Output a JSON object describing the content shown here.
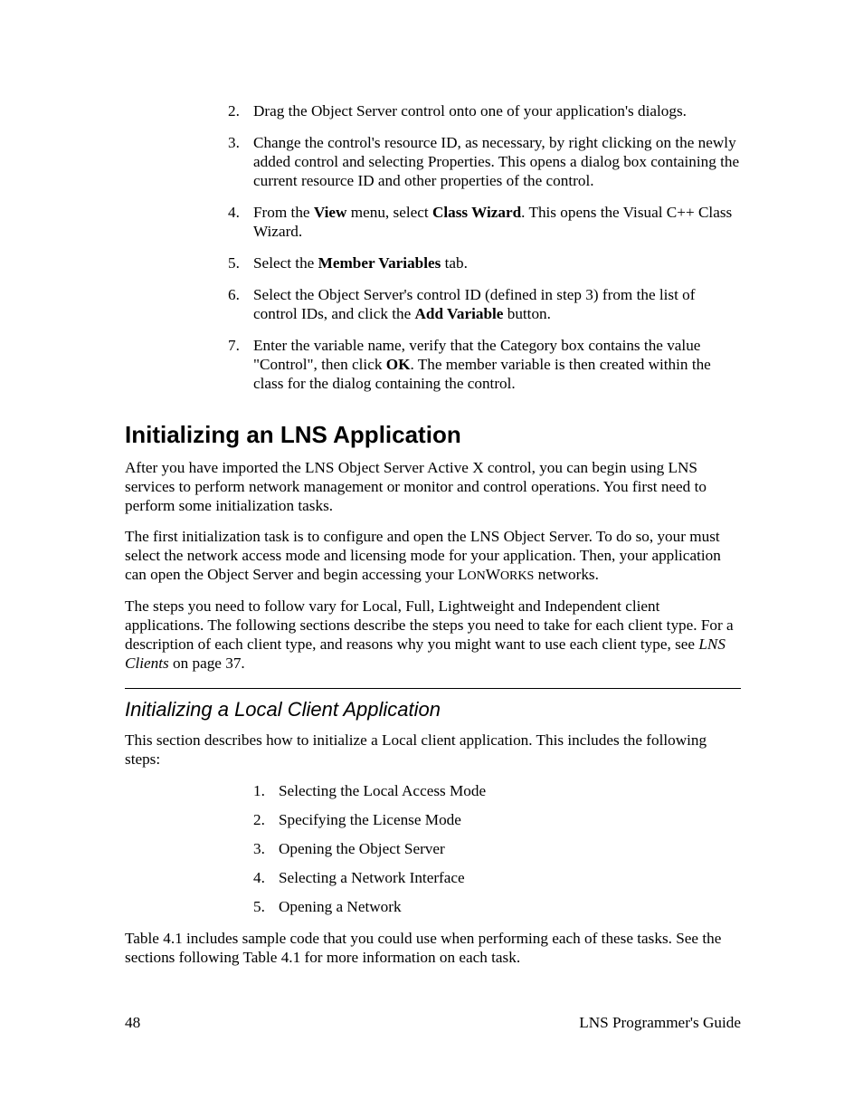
{
  "list1": {
    "n2": "2.",
    "i2": "Drag the Object Server control onto one of your application's dialogs.",
    "n3": "3.",
    "i3": "Change the control's resource ID, as necessary, by right clicking on the newly added control and selecting Properties. This opens a dialog box containing the current resource ID and other properties of the control.",
    "n4": "4.",
    "i4a": "From the ",
    "i4b": "View",
    "i4c": " menu, select ",
    "i4d": "Class Wizard",
    "i4e": ". This opens the Visual C++ Class Wizard.",
    "n5": "5.",
    "i5a": "Select the ",
    "i5b": "Member Variables",
    "i5c": " tab.",
    "n6": "6.",
    "i6a": "Select the Object Server's control ID (defined in step 3) from the list of control IDs, and click the ",
    "i6b": "Add Variable",
    "i6c": " button.",
    "n7": "7.",
    "i7a": "Enter the variable name, verify that the Category box contains the value \"Control\", then click ",
    "i7b": "OK",
    "i7c": ". The member variable is then created within the class for the dialog containing the control."
  },
  "h1": "Initializing an LNS Application",
  "p1": "After you have imported the LNS Object Server Active X control, you can begin using LNS services to perform network management or monitor and control operations. You first need to perform some initialization tasks.",
  "p2a": "The first initialization task is to configure and open the LNS Object Server. To do so, your must select the network access mode and licensing mode for your application. Then, your application can open the Object Server and begin accessing your L",
  "p2b": "ON",
  "p2c": "W",
  "p2d": "ORKS",
  "p2e": " networks.",
  "p3a": "The steps you need to follow vary for Local, Full, Lightweight and Independent client applications. The following sections describe the steps you need to take for each client type. For a description of each client type, and reasons why you might want to use each client type, see ",
  "p3b": "LNS Clients",
  "p3c": " on page 37.",
  "h2": "Initializing a Local Client Application",
  "p4": "This section describes how to initialize a Local client application. This includes the following steps:",
  "list2": {
    "n1": "1.",
    "i1": "Selecting the Local Access Mode",
    "n2": "2.",
    "i2": "Specifying the License Mode",
    "n3": "3.",
    "i3": "Opening the Object Server",
    "n4": "4.",
    "i4": "Selecting a Network Interface",
    "n5": "5.",
    "i5": "Opening a Network"
  },
  "p5": "Table 4.1 includes sample code that you could use when performing each of these tasks. See the sections following Table 4.1 for more information on each task.",
  "footer": {
    "page": "48",
    "title": "LNS Programmer's Guide"
  }
}
